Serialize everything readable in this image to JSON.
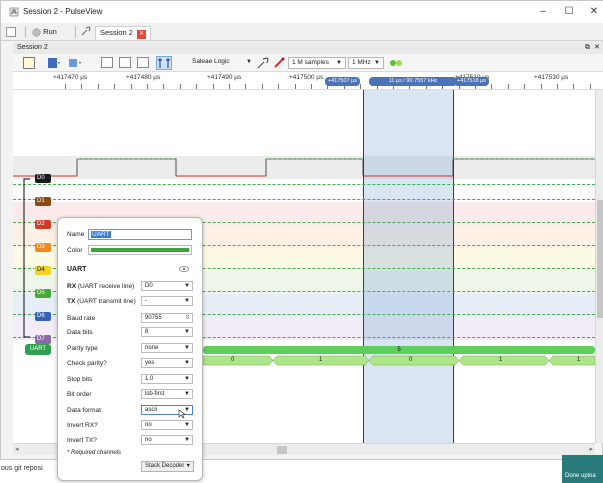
{
  "window": {
    "title": "Session 2 - PulseView",
    "minimize": "–",
    "maximize": "☐",
    "close": "✕"
  },
  "tabbar": {
    "run_label": "Run",
    "session_tab": "Session 2",
    "session_close": "✕"
  },
  "doc_label": "Session 2",
  "toolbar": {
    "device": "Saleae Logic",
    "samples": "1 M samples",
    "rate": "1 MHz"
  },
  "ruler": {
    "labels": [
      "+417470 µs",
      "+417480 µs",
      "+417490 µs",
      "+417500 µs",
      "+417510 µs",
      "+417530 µs"
    ],
    "marker_left": "+417507 µs",
    "marker_mid": "11 µs / 90.7557 kHz",
    "marker_right": "+417518 µs"
  },
  "channels": [
    {
      "label": "D0",
      "color": "#1a1a1a",
      "text_color": "#ffffff"
    },
    {
      "label": "D1",
      "color": "#8a4a12",
      "text_color": "#ffffff"
    },
    {
      "label": "D2",
      "color": "#d23a2a",
      "text_color": "#ffffff"
    },
    {
      "label": "D3",
      "color": "#f08a1d",
      "text_color": "#ffffff"
    },
    {
      "label": "D4",
      "color": "#f1d42a",
      "text_color": "#111111"
    },
    {
      "label": "D5",
      "color": "#49a93a",
      "text_color": "#ffffff"
    },
    {
      "label": "D6",
      "color": "#3462b5",
      "text_color": "#ffffff"
    },
    {
      "label": "D7",
      "color": "#8d6aa8",
      "text_color": "#ffffff"
    }
  ],
  "decoder_tag": "UART",
  "decoder_row": {
    "top_value": "5",
    "bits": [
      "0",
      "1",
      "0",
      "1",
      "1"
    ]
  },
  "popup": {
    "name_label": "Name",
    "name_value": "UART",
    "color_label": "Color",
    "decoder_title": "UART",
    "rx_label_bold": "RX",
    "rx_label_rest": "(UART receive line)",
    "rx_value": "D0",
    "tx_label_bold": "TX",
    "tx_label_rest": "(UART transmit line)",
    "tx_value": "-",
    "baud_label": "Baud rate",
    "baud_value": "90755",
    "databits_label": "Data bits",
    "databits_value": "8",
    "parity_label": "Parity type",
    "parity_value": "none",
    "checkparity_label": "Check parity?",
    "checkparity_value": "yes",
    "stopbits_label": "Stop bits",
    "stopbits_value": "1.0",
    "bitorder_label": "Bit order",
    "bitorder_value": "lsb-first",
    "dataformat_label": "Data format",
    "dataformat_value": "ascii",
    "invertrx_label": "Invert RX?",
    "invertrx_value": "no",
    "inverttx_label": "Invert TX?",
    "inverttx_value": "no",
    "required_note": "* Required channels",
    "stack_button": "Stack Decoder"
  },
  "background": {
    "left_text": "ous git reposi",
    "right_text": "Done uploa"
  }
}
